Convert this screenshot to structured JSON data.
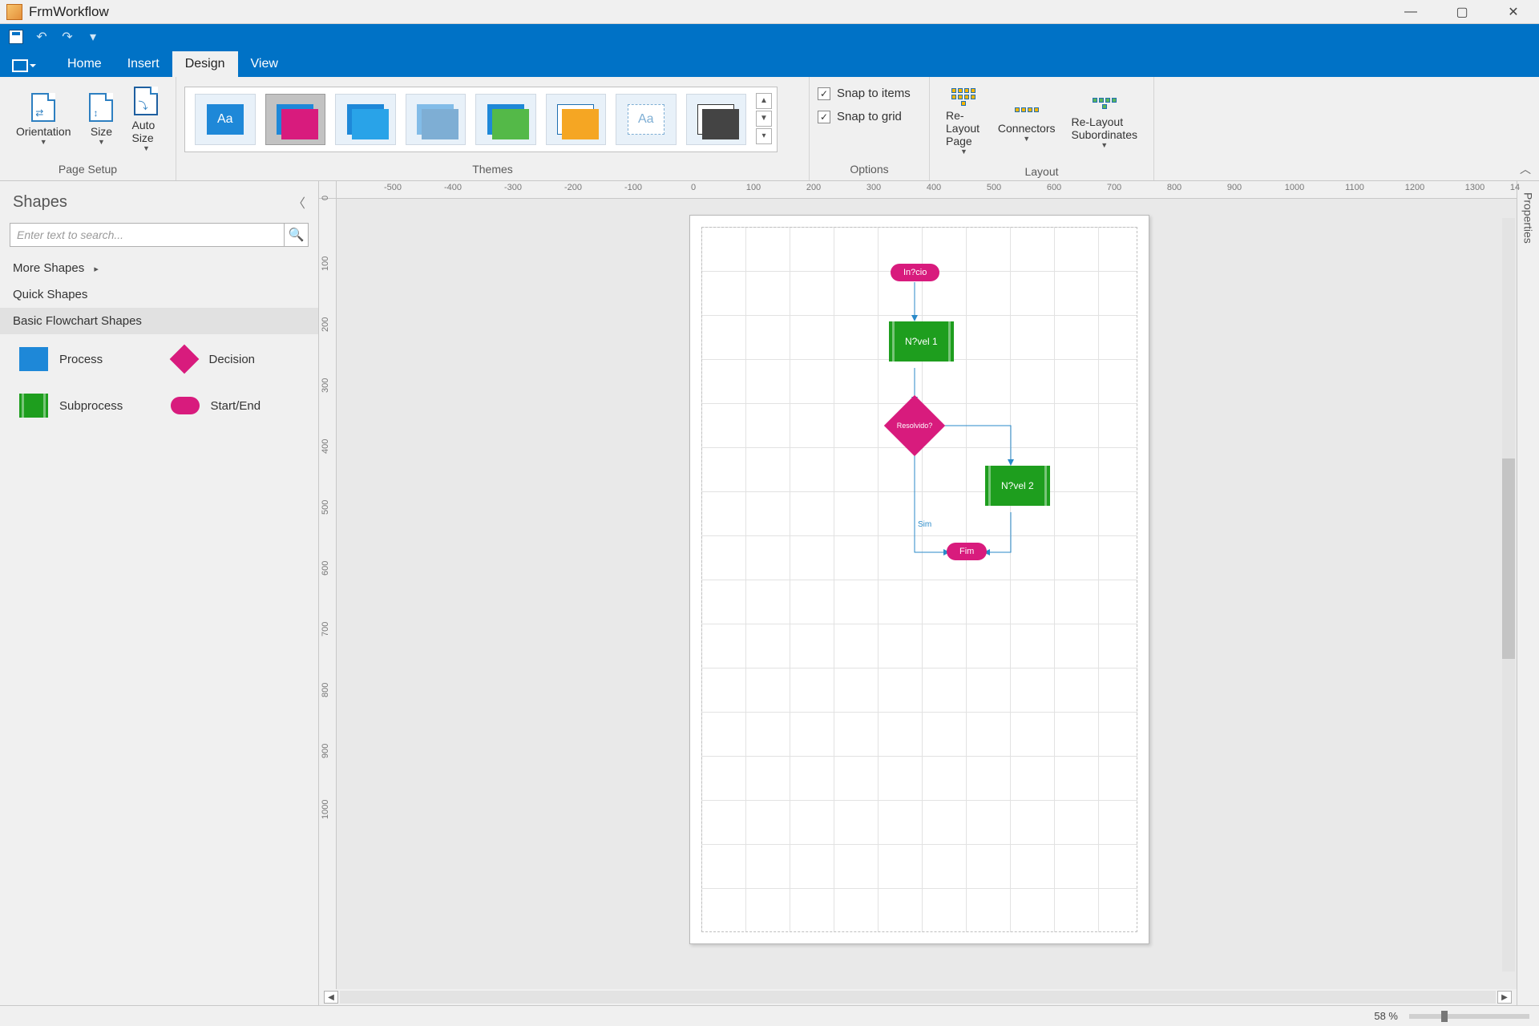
{
  "window": {
    "title": "FrmWorkflow"
  },
  "tabs": {
    "home": "Home",
    "insert": "Insert",
    "design": "Design",
    "view": "View",
    "active": "Design"
  },
  "ribbon": {
    "page_setup": {
      "label": "Page Setup",
      "orientation": "Orientation",
      "size": "Size",
      "auto_size": "Auto Size"
    },
    "themes": {
      "label": "Themes"
    },
    "options": {
      "label": "Options",
      "snap_items": "Snap to items",
      "snap_grid": "Snap to grid"
    },
    "layout": {
      "label": "Layout",
      "relayout_page": "Re-Layout Page",
      "connectors": "Connectors",
      "relayout_sub": "Re-Layout Subordinates"
    }
  },
  "shapes": {
    "title": "Shapes",
    "search_placeholder": "Enter text to search...",
    "more": "More Shapes",
    "quick": "Quick Shapes",
    "basic": "Basic Flowchart Shapes",
    "process": "Process",
    "decision": "Decision",
    "subprocess": "Subprocess",
    "startend": "Start/End"
  },
  "properties": {
    "tab": "Properties"
  },
  "ruler_h": [
    "-500",
    "-400",
    "-300",
    "-200",
    "-100",
    "0",
    "100",
    "200",
    "300",
    "400",
    "500",
    "600",
    "700",
    "800",
    "900",
    "1000",
    "1100",
    "1200",
    "1300",
    "14"
  ],
  "ruler_v": [
    "0",
    "100",
    "200",
    "300",
    "400",
    "500",
    "600",
    "700",
    "800",
    "900",
    "1000"
  ],
  "flow": {
    "start": "In?cio",
    "lvl1": "N?vel 1",
    "dec": "Resolvido?",
    "lvl2": "N?vel 2",
    "end": "Fim",
    "yes": "Sim"
  },
  "status": {
    "zoom": "58 %"
  }
}
